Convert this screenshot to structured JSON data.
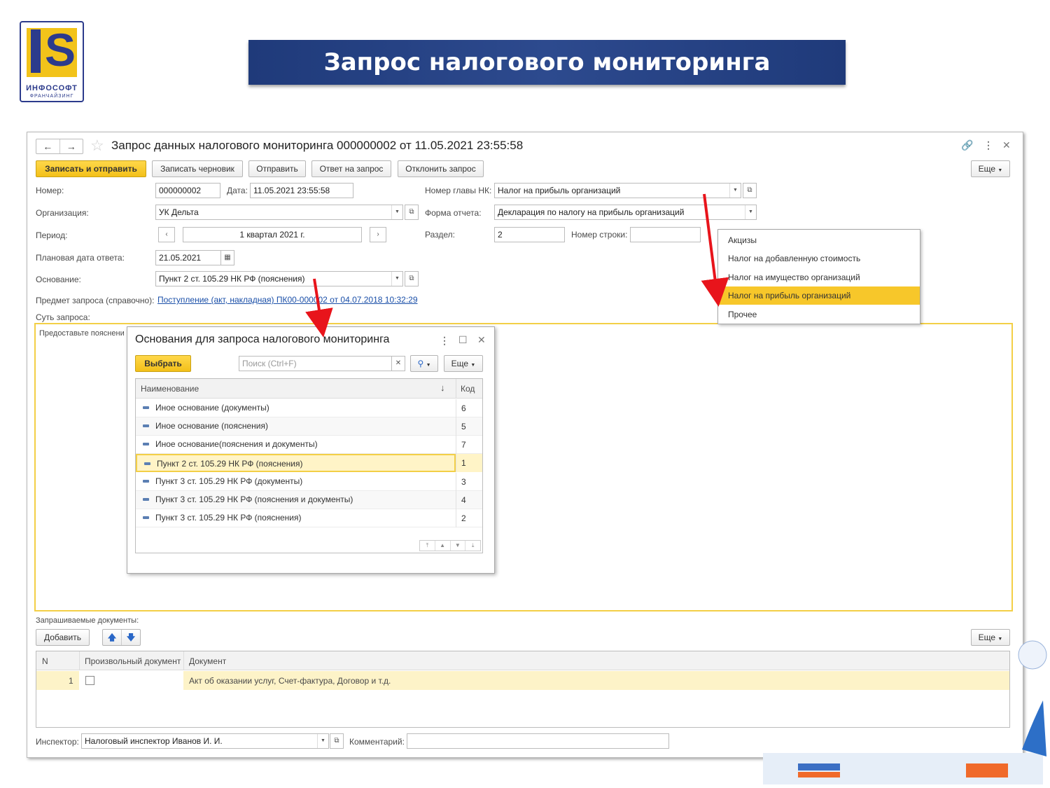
{
  "logo": {
    "line1": "ИНФОСОФТ",
    "line2": "ФРАНЧАЙЗИНГ"
  },
  "slide_title": "Запрос налогового мониторинга",
  "window": {
    "title": "Запрос данных налогового мониторинга 000000002 от 11.05.2021 23:55:58"
  },
  "toolbar": {
    "save_send": "Записать и отправить",
    "save_draft": "Записать черновик",
    "send": "Отправить",
    "reply": "Ответ на запрос",
    "reject": "Отклонить запрос",
    "more": "Еще"
  },
  "form": {
    "number_label": "Номер:",
    "number_value": "000000002",
    "date_label": "Дата:",
    "date_value": "11.05.2021 23:55:58",
    "chapter_label": "Номер главы НК:",
    "chapter_value": "Налог на прибыль организаций",
    "org_label": "Организация:",
    "org_value": "УК Дельта",
    "report_label": "Форма отчета:",
    "report_value": "Декларация по налогу на прибыль организаций",
    "period_label": "Период:",
    "period_value": "1 квартал 2021 г.",
    "section_label": "Раздел:",
    "section_value": "2",
    "line_label": "Номер строки:",
    "line_value": "",
    "plan_date_label": "Плановая дата ответа:",
    "plan_date_value": "21.05.2021",
    "basis_label": "Основание:",
    "basis_value": "Пункт 2 ст. 105.29 НК РФ (пояснения)",
    "subject_label": "Предмет запроса (справочно):",
    "subject_link": "Поступление (акт, накладная) ПК00-000002 от 04.07.2018 10:32:29",
    "essence_label": "Суть запроса:",
    "essence_text": "Предоставьте пояснени"
  },
  "popup": {
    "items": [
      "Акцизы",
      "Налог на добавленную стоимость",
      "Налог на имущество организаций",
      "Налог на прибыль организаций",
      "Прочее"
    ],
    "selected": "Налог на прибыль организаций"
  },
  "dialog": {
    "title": "Основания для запроса налогового мониторинга",
    "select_label": "Выбрать",
    "search_placeholder": "Поиск (Ctrl+F)",
    "more": "Еще",
    "col_name": "Наименование",
    "col_code": "Код",
    "rows": [
      {
        "name": "Иное основание (документы)",
        "code": "6"
      },
      {
        "name": "Иное основание (пояснения)",
        "code": "5"
      },
      {
        "name": "Иное основание(пояснения и документы)",
        "code": "7"
      },
      {
        "name": "Пункт 2 ст. 105.29 НК РФ (пояснения)",
        "code": "1"
      },
      {
        "name": "Пункт 3 ст. 105.29 НК РФ (документы)",
        "code": "3"
      },
      {
        "name": "Пункт 3 ст. 105.29 НК РФ (пояснения и документы)",
        "code": "4"
      },
      {
        "name": "Пункт 3 ст. 105.29 НК РФ (пояснения)",
        "code": "2"
      }
    ],
    "selected_row": 3
  },
  "docs": {
    "label": "Запрашиваемые документы:",
    "add_label": "Добавить",
    "more": "Еще",
    "col_n": "N",
    "col_custom": "Произвольный документ",
    "col_doc": "Документ",
    "rows": [
      {
        "n": "1",
        "custom": false,
        "doc": "Акт об оказании услуг, Счет-фактура, Договор и т.д."
      }
    ]
  },
  "footer": {
    "inspector_label": "Инспектор:",
    "inspector_value": "Налоговый инспектор Иванов И. И.",
    "comment_label": "Комментарий:",
    "comment_value": ""
  },
  "colors": {
    "accent_yellow": "#f3c019",
    "title_band": "#2d4a8e",
    "link": "#1a4fa8",
    "arrow": "#e8141b"
  }
}
